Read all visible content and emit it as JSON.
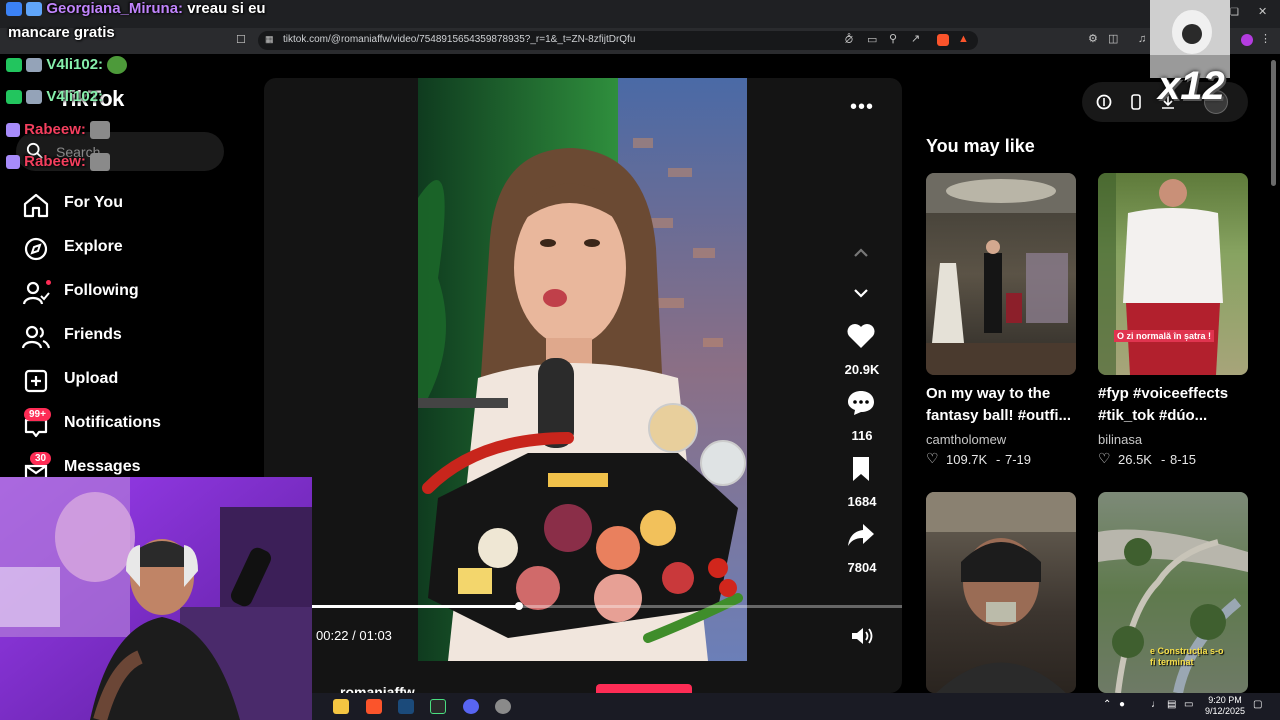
{
  "browser": {
    "url": "tiktok.com/@romaniaffw/video/7548915654359878935?_r=1&_t=ZN-8zfijtDrQfu"
  },
  "sidebar": {
    "logo": "TikTok",
    "search_placeholder": "Search",
    "items": [
      {
        "label": "For You",
        "icon": "home-icon"
      },
      {
        "label": "Explore",
        "icon": "compass-icon"
      },
      {
        "label": "Following",
        "icon": "following-icon"
      },
      {
        "label": "Friends",
        "icon": "friends-icon"
      },
      {
        "label": "Upload",
        "icon": "upload-icon"
      },
      {
        "label": "Notifications",
        "icon": "bell-icon",
        "badge": "99+"
      },
      {
        "label": "Messages",
        "icon": "messages-icon",
        "badge": "30"
      }
    ]
  },
  "video": {
    "likes": "20.9K",
    "comments": "116",
    "saves": "1684",
    "shares": "7804",
    "time": "00:22 / 01:03",
    "progress": 0.35,
    "author": "romaniaffw"
  },
  "recommendations": {
    "title": "You may like",
    "cards": [
      {
        "title": "On my way to the fantasy ball! #outfi...",
        "author": "camtholomew",
        "likes": "109.7K",
        "date": "7-19"
      },
      {
        "title": "#fyp #voiceeffects #tik_tok #dúo...",
        "author": "bilinasa",
        "likes": "26.5K",
        "date": "8-15",
        "caption": "O zi normală în șatra !"
      },
      {
        "title": "",
        "author": "",
        "likes": "",
        "date": ""
      },
      {
        "title": "",
        "author": "",
        "likes": "",
        "date": "",
        "caption": "e Construcția s-o fi terminat"
      }
    ]
  },
  "overlay": {
    "chat": [
      {
        "user": "Georgiana_Miruna:",
        "message": "vreau si eu",
        "color": "#c084fc"
      },
      {
        "user": "",
        "message": "mancare gratis",
        "color": "#ffffff"
      },
      {
        "user": "V4li102:",
        "message": "",
        "color": "#86efac"
      },
      {
        "user": "V4li102:",
        "message": "",
        "color": "#86efac"
      },
      {
        "user": "Rabeew:",
        "message": "",
        "color": "#f43f5e"
      },
      {
        "user": "Rabeew:",
        "message": "",
        "color": "#f43f5e"
      }
    ],
    "multiplier": "x12"
  },
  "taskbar": {
    "time": "9:20 PM",
    "date": "9/12/2025"
  },
  "colors": {
    "accent": "#fe2c55",
    "background": "#000000",
    "panel": "#141414"
  }
}
